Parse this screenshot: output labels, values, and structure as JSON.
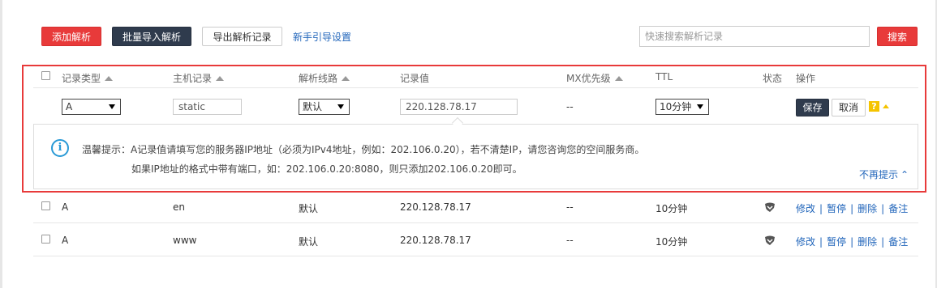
{
  "toolbar": {
    "add_label": "添加解析",
    "bulk_import_label": "批量导入解析",
    "export_label": "导出解析记录",
    "guide_link": "新手引导设置",
    "search_placeholder": "快速搜索解析记录",
    "search_button": "搜索"
  },
  "table": {
    "headers": {
      "type": "记录类型",
      "host": "主机记录",
      "line": "解析线路",
      "value": "记录值",
      "mx": "MX优先级",
      "ttl": "TTL",
      "status": "状态",
      "action": "操作"
    },
    "edit_row": {
      "type": "A",
      "host": "static",
      "line": "默认",
      "value": "220.128.78.17",
      "mx": "--",
      "ttl": "10分钟",
      "save": "保存",
      "cancel": "取消",
      "help": "?"
    },
    "tip": {
      "line1": "温馨提示：A记录值请填写您的服务器IP地址（必须为IPv4地址，例如：202.106.0.20），若不清楚IP，请您咨询您的空间服务商。",
      "line2": "如果IP地址的格式中带有端口，如：202.106.0.20:8080，则只添加202.106.0.20即可。",
      "dismiss": "不再提示"
    },
    "rows": [
      {
        "type": "A",
        "host": "en",
        "line": "默认",
        "value": "220.128.78.17",
        "mx": "--",
        "ttl": "10分钟",
        "ops": [
          "修改",
          "暂停",
          "删除",
          "备注"
        ]
      },
      {
        "type": "A",
        "host": "www",
        "line": "默认",
        "value": "220.128.78.17",
        "mx": "--",
        "ttl": "10分钟",
        "ops": [
          "修改",
          "暂停",
          "删除",
          "备注"
        ]
      }
    ]
  },
  "colors": {
    "red": "#e83a3a",
    "dark": "#2f3b4d",
    "link": "#2266bb",
    "info": "#2a9ad6",
    "help": "#f5c400"
  }
}
